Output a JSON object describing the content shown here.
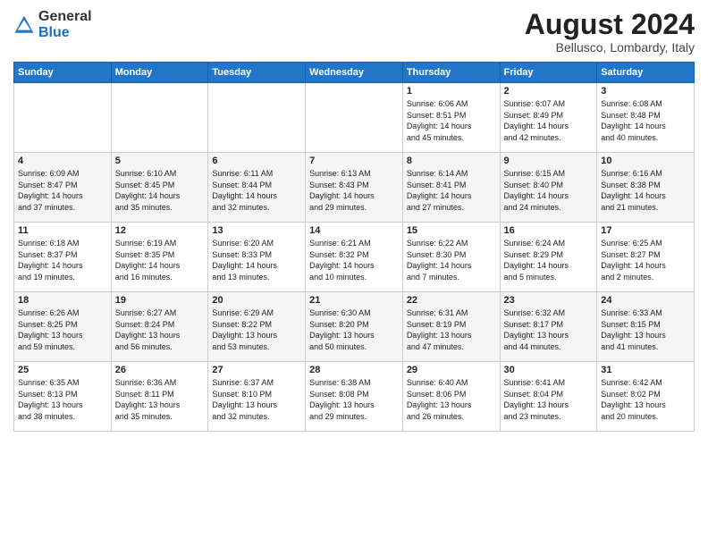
{
  "logo": {
    "general": "General",
    "blue": "Blue"
  },
  "title": {
    "month_year": "August 2024",
    "location": "Bellusco, Lombardy, Italy"
  },
  "days_of_week": [
    "Sunday",
    "Monday",
    "Tuesday",
    "Wednesday",
    "Thursday",
    "Friday",
    "Saturday"
  ],
  "weeks": [
    [
      {
        "day": "",
        "info": ""
      },
      {
        "day": "",
        "info": ""
      },
      {
        "day": "",
        "info": ""
      },
      {
        "day": "",
        "info": ""
      },
      {
        "day": "1",
        "info": "Sunrise: 6:06 AM\nSunset: 8:51 PM\nDaylight: 14 hours\nand 45 minutes."
      },
      {
        "day": "2",
        "info": "Sunrise: 6:07 AM\nSunset: 8:49 PM\nDaylight: 14 hours\nand 42 minutes."
      },
      {
        "day": "3",
        "info": "Sunrise: 6:08 AM\nSunset: 8:48 PM\nDaylight: 14 hours\nand 40 minutes."
      }
    ],
    [
      {
        "day": "4",
        "info": "Sunrise: 6:09 AM\nSunset: 8:47 PM\nDaylight: 14 hours\nand 37 minutes."
      },
      {
        "day": "5",
        "info": "Sunrise: 6:10 AM\nSunset: 8:45 PM\nDaylight: 14 hours\nand 35 minutes."
      },
      {
        "day": "6",
        "info": "Sunrise: 6:11 AM\nSunset: 8:44 PM\nDaylight: 14 hours\nand 32 minutes."
      },
      {
        "day": "7",
        "info": "Sunrise: 6:13 AM\nSunset: 8:43 PM\nDaylight: 14 hours\nand 29 minutes."
      },
      {
        "day": "8",
        "info": "Sunrise: 6:14 AM\nSunset: 8:41 PM\nDaylight: 14 hours\nand 27 minutes."
      },
      {
        "day": "9",
        "info": "Sunrise: 6:15 AM\nSunset: 8:40 PM\nDaylight: 14 hours\nand 24 minutes."
      },
      {
        "day": "10",
        "info": "Sunrise: 6:16 AM\nSunset: 8:38 PM\nDaylight: 14 hours\nand 21 minutes."
      }
    ],
    [
      {
        "day": "11",
        "info": "Sunrise: 6:18 AM\nSunset: 8:37 PM\nDaylight: 14 hours\nand 19 minutes."
      },
      {
        "day": "12",
        "info": "Sunrise: 6:19 AM\nSunset: 8:35 PM\nDaylight: 14 hours\nand 16 minutes."
      },
      {
        "day": "13",
        "info": "Sunrise: 6:20 AM\nSunset: 8:33 PM\nDaylight: 14 hours\nand 13 minutes."
      },
      {
        "day": "14",
        "info": "Sunrise: 6:21 AM\nSunset: 8:32 PM\nDaylight: 14 hours\nand 10 minutes."
      },
      {
        "day": "15",
        "info": "Sunrise: 6:22 AM\nSunset: 8:30 PM\nDaylight: 14 hours\nand 7 minutes."
      },
      {
        "day": "16",
        "info": "Sunrise: 6:24 AM\nSunset: 8:29 PM\nDaylight: 14 hours\nand 5 minutes."
      },
      {
        "day": "17",
        "info": "Sunrise: 6:25 AM\nSunset: 8:27 PM\nDaylight: 14 hours\nand 2 minutes."
      }
    ],
    [
      {
        "day": "18",
        "info": "Sunrise: 6:26 AM\nSunset: 8:25 PM\nDaylight: 13 hours\nand 59 minutes."
      },
      {
        "day": "19",
        "info": "Sunrise: 6:27 AM\nSunset: 8:24 PM\nDaylight: 13 hours\nand 56 minutes."
      },
      {
        "day": "20",
        "info": "Sunrise: 6:29 AM\nSunset: 8:22 PM\nDaylight: 13 hours\nand 53 minutes."
      },
      {
        "day": "21",
        "info": "Sunrise: 6:30 AM\nSunset: 8:20 PM\nDaylight: 13 hours\nand 50 minutes."
      },
      {
        "day": "22",
        "info": "Sunrise: 6:31 AM\nSunset: 8:19 PM\nDaylight: 13 hours\nand 47 minutes."
      },
      {
        "day": "23",
        "info": "Sunrise: 6:32 AM\nSunset: 8:17 PM\nDaylight: 13 hours\nand 44 minutes."
      },
      {
        "day": "24",
        "info": "Sunrise: 6:33 AM\nSunset: 8:15 PM\nDaylight: 13 hours\nand 41 minutes."
      }
    ],
    [
      {
        "day": "25",
        "info": "Sunrise: 6:35 AM\nSunset: 8:13 PM\nDaylight: 13 hours\nand 38 minutes."
      },
      {
        "day": "26",
        "info": "Sunrise: 6:36 AM\nSunset: 8:11 PM\nDaylight: 13 hours\nand 35 minutes."
      },
      {
        "day": "27",
        "info": "Sunrise: 6:37 AM\nSunset: 8:10 PM\nDaylight: 13 hours\nand 32 minutes."
      },
      {
        "day": "28",
        "info": "Sunrise: 6:38 AM\nSunset: 8:08 PM\nDaylight: 13 hours\nand 29 minutes."
      },
      {
        "day": "29",
        "info": "Sunrise: 6:40 AM\nSunset: 8:06 PM\nDaylight: 13 hours\nand 26 minutes."
      },
      {
        "day": "30",
        "info": "Sunrise: 6:41 AM\nSunset: 8:04 PM\nDaylight: 13 hours\nand 23 minutes."
      },
      {
        "day": "31",
        "info": "Sunrise: 6:42 AM\nSunset: 8:02 PM\nDaylight: 13 hours\nand 20 minutes."
      }
    ]
  ]
}
